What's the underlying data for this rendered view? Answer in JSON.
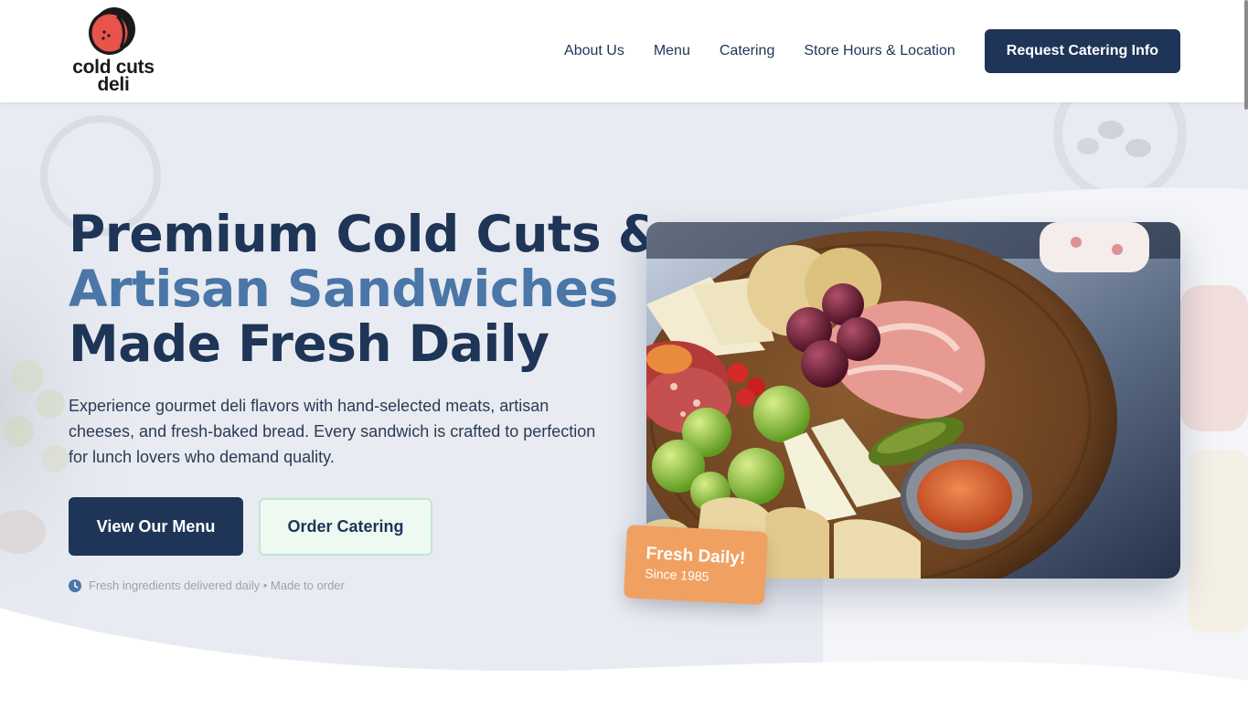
{
  "brand": {
    "name_line1": "cold cuts",
    "name_line2": "deli",
    "logo_icon": "ham-icon"
  },
  "nav": {
    "items": [
      "About Us",
      "Menu",
      "Catering",
      "Store Hours & Location"
    ],
    "cta": "Request Catering Info"
  },
  "hero": {
    "headline_line1": "Premium Cold Cuts &",
    "headline_line2": "Artisan Sandwiches",
    "headline_line3": "Made Fresh Daily",
    "subtext": "Experience gourmet deli flavors with hand-selected meats, artisan cheeses, and fresh-baked bread. Every sandwich is crafted to perfection for lunch lovers who demand quality.",
    "primary_button": "View Our Menu",
    "secondary_button": "Order Catering",
    "note": "Fresh ingredients delivered daily • Made to order",
    "note_icon": "clock-icon",
    "badge_title": "Fresh Daily!",
    "badge_subtitle": "Since 1985"
  },
  "colors": {
    "navy": "#1e3557",
    "accent_blue": "#4a76a8",
    "badge_orange": "#f0a161",
    "logo_red": "#e8534a",
    "secondary_button_bg": "#eef9f2"
  }
}
